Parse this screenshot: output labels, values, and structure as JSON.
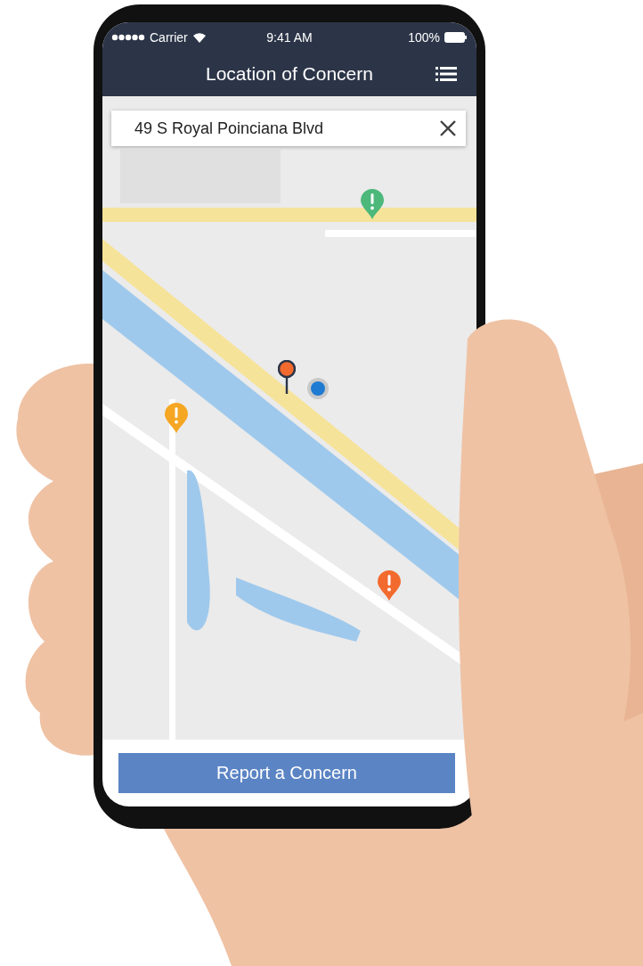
{
  "status_bar": {
    "carrier": "Carrier",
    "time": "9:41 AM",
    "battery": "100%"
  },
  "header": {
    "title": "Location of Concern"
  },
  "search": {
    "value": "49 S Royal Poinciana Blvd"
  },
  "map": {
    "kind": "picture",
    "pins": [
      {
        "kind": "alert",
        "color": "#4cb87a"
      },
      {
        "kind": "alert",
        "color": "#f5a623"
      },
      {
        "kind": "alert",
        "color": "#f26a2e"
      },
      {
        "kind": "dropped",
        "color": "#f26a2e"
      },
      {
        "kind": "current",
        "color": "#1e7bd1"
      }
    ]
  },
  "button": {
    "label": "Report a Concern"
  }
}
